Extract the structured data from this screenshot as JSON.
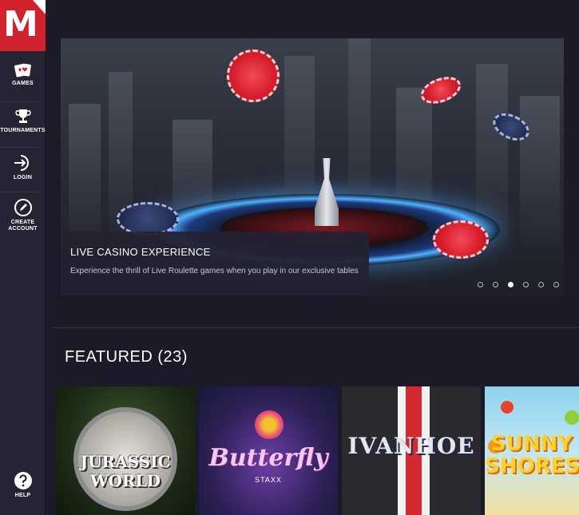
{
  "brand": {
    "logo_letter": "M",
    "accent": "#d2222e"
  },
  "sidebar": {
    "items": [
      {
        "label": "GAMES",
        "icon": "playing-cards-icon"
      },
      {
        "label": "TOURNAMENTS",
        "icon": "trophy-icon"
      },
      {
        "label": "LOGIN",
        "icon": "login-icon"
      },
      {
        "label": "CREATE ACCOUNT",
        "icon": "pencil-icon"
      }
    ],
    "help": {
      "label": "HELP",
      "icon": "question-icon"
    }
  },
  "banner": {
    "title": "LIVE CASINO EXPERIENCE",
    "description": "Experience the thrill of Live Roulette games when you play in our exclusive tables",
    "slide_count": 6,
    "active_slide": 3
  },
  "featured": {
    "title": "FEATURED (23)",
    "games": [
      {
        "name": "JURASSIC WORLD"
      },
      {
        "name": "Butterfly",
        "subtitle": "STAXX"
      },
      {
        "name": "IVANHOE"
      },
      {
        "name": "SUNNY SHORES"
      }
    ]
  }
}
